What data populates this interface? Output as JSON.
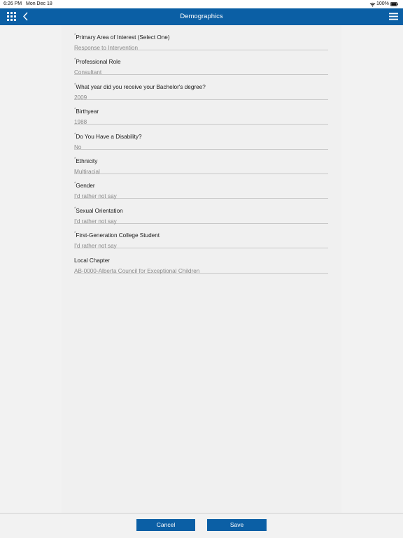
{
  "status_bar": {
    "time": "6:26 PM",
    "date": "Mon Dec 18",
    "battery": "100%"
  },
  "navbar": {
    "title": "Demographics",
    "background_color": "#0b5fa5"
  },
  "form": {
    "fields": [
      {
        "label": "Primary Area of Interest (Select One)",
        "value": "Response to Intervention",
        "required": true
      },
      {
        "label": "Professional Role",
        "value": "Consultant",
        "required": true
      },
      {
        "label": "What year did you receive your Bachelor's degree?",
        "value": "2009",
        "required": true
      },
      {
        "label": "Birthyear",
        "value": "1988",
        "required": true
      },
      {
        "label": "Do You Have a Disability?",
        "value": "No",
        "required": true
      },
      {
        "label": "Ethnicity",
        "value": "Multiracial",
        "required": true
      },
      {
        "label": "Gender",
        "value": "I'd rather not say",
        "required": true
      },
      {
        "label": "Sexual Orientation",
        "value": "I'd rather not say",
        "required": true
      },
      {
        "label": "First-Generation College Student",
        "value": "I'd rather not say",
        "required": true
      },
      {
        "label": "Local Chapter",
        "value": "AB-0000-Alberta Council for Exceptional Children",
        "required": false
      }
    ],
    "required_marker": "*"
  },
  "footer": {
    "cancel_label": "Cancel",
    "save_label": "Save"
  }
}
